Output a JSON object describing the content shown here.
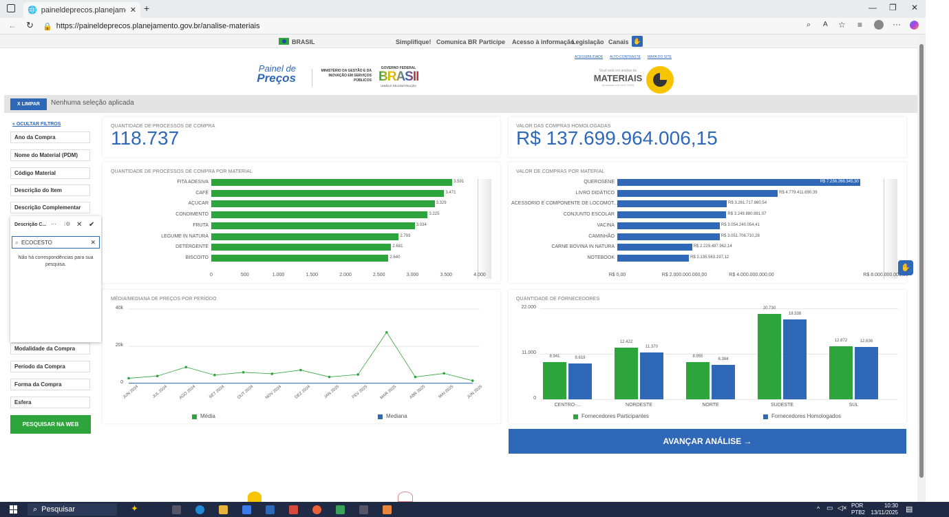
{
  "browser": {
    "tab_title": "paineldeprecos.planejamento.go",
    "url": "https://paineldeprecos.planejamento.gov.br/analise-materiais"
  },
  "gov_bar": {
    "country": "BRASIL",
    "links": [
      "Simplifique!",
      "Comunica BR",
      "Participe",
      "Acesso à informação",
      "Legislação",
      "Canais"
    ]
  },
  "header": {
    "logo_line1": "Painel de",
    "logo_line2": "Preços",
    "ministry": "MINISTÉRIO DA GESTÃO E DA INOVAÇÃO EM SERVIÇOS PÚBLICOS",
    "gov_label": "GOVERNO FEDERAL",
    "gov_word": "BRASIL",
    "gov_sub": "UNIÃO E RECONSTRUÇÃO",
    "access_links": [
      "ACESSIBILIDADE",
      "ALTO CONTRASTE",
      "MAPA DO SITE"
    ],
    "subtitle": "Você está em análise de",
    "title": "MATERIAIS",
    "updated": "Atualizado em 04/07/2025"
  },
  "selection": {
    "clear_label": "X LIMPAR",
    "status": "Nenhuma seleção aplicada"
  },
  "sidebar": {
    "hide_label": "« OCULTAR FILTROS",
    "filters_top": [
      "Ano da Compra",
      "Nome do Material (PDM)",
      "Código Material",
      "Descrição do Item",
      "Descrição Complementar"
    ],
    "filters_bottom": [
      "Modalidade da Compra",
      "Período da Compra",
      "Forma da Compra",
      "Esfera"
    ],
    "search_web": "PESQUISAR NA WEB"
  },
  "popup": {
    "title": "Descrição C...",
    "search_value": "ECOCESTO",
    "empty": "Não há correspondências para sua pesquisa."
  },
  "kpi": {
    "processes_title": "QUANTIDADE DE PROCESSOS DE COMPRA",
    "processes_value": "118.737",
    "value_title": "VALOR DAS COMPRAS HOMOLOGADAS",
    "value_value": "R$ 137.699.964.006,15"
  },
  "chart_data": [
    {
      "type": "bar",
      "orientation": "horizontal",
      "title": "QUANTIDADE DE PROCESSOS DE COMPRA POR MATERIAL",
      "categories": [
        "FITA ADESIVA",
        "CAFÉ",
        "AÇÚCAR",
        "CONDIMENTO",
        "FRUTA",
        "LEGUME IN NATURA",
        "DETERGENTE",
        "BISCOITO"
      ],
      "values": [
        3591,
        3471,
        3329,
        3225,
        3034,
        2793,
        2681,
        2640
      ],
      "value_labels": [
        "3.591",
        "3.471",
        "3.329",
        "3.225",
        "3.034",
        "2.793",
        "2.681",
        "2.640"
      ],
      "xlim": [
        0,
        4000
      ],
      "xticks": [
        "0",
        "500",
        "1.000",
        "1.500",
        "2.000",
        "2.500",
        "3.000",
        "3.500",
        "4.000"
      ],
      "color": "#2ea43c"
    },
    {
      "type": "bar",
      "orientation": "horizontal",
      "title": "VALOR DE COMPRAS POR MATERIAL",
      "categories": [
        "QUEROSENE",
        "LIVRO DIDÁTICO",
        "ACESSORIO E COMPONENTE DE LOCOMOT...",
        "CONJUNTO ESCOLAR",
        "VACINA",
        "CAMINHÃO",
        "CARNE BOVINA IN NATURA",
        "NOTEBOOK"
      ],
      "values": [
        7236266345.3,
        4779411690.39,
        3261717860.54,
        3249880881.07,
        3054240054.41,
        3051706710.28,
        2229497962.14,
        2135563197.12
      ],
      "value_labels": [
        "R$ 7.236.266.345,30",
        "R$ 4.779.411.690,39",
        "R$ 3.261.717.860,54",
        "R$ 3.249.880.881,07",
        "R$ 3.054.240.054,41",
        "R$ 3.051.706.710,28",
        "R$ 2.229.497.962,14",
        "R$ 2.135.563.197,12"
      ],
      "xlim": [
        0,
        8000000000
      ],
      "xticks": [
        "R$ 0,00",
        "R$ 2.000.000.000,00",
        "R$ 4.000.000.000,00",
        "R$ 8.000.000.000,00"
      ],
      "color": "#2f68b6"
    },
    {
      "type": "line",
      "title": "MÉDIA/MEDIANA DE PREÇOS POR PERÍODO",
      "x": [
        "JUN 2024",
        "JUL 2024",
        "AGO 2024",
        "SET 2024",
        "OUT 2024",
        "NOV 2024",
        "DEZ 2024",
        "JAN 2025",
        "FEV 2025",
        "MAR 2025",
        "ABR 2025",
        "MAI 2025",
        "JUN 2025"
      ],
      "ylim": [
        0,
        40000
      ],
      "yticks": [
        "0",
        "20k",
        "40k"
      ],
      "series": [
        {
          "name": "Média",
          "color": "#2ea43c",
          "values": [
            2800,
            4000,
            8800,
            4500,
            6000,
            5200,
            7200,
            3500,
            4800,
            27500,
            3500,
            5400,
            1500
          ]
        },
        {
          "name": "Mediana",
          "color": "#2f68b6",
          "values": [
            150,
            150,
            150,
            150,
            150,
            150,
            150,
            150,
            150,
            150,
            150,
            150,
            150
          ]
        }
      ]
    },
    {
      "type": "bar",
      "title": "QUANTIDADE DE FORNECEDORES",
      "categories": [
        "CENTRO-...",
        "NORDESTE",
        "NORTE",
        "SUDESTE",
        "SUL"
      ],
      "ylim": [
        0,
        22000
      ],
      "yticks": [
        "0",
        "11.000",
        "22.000"
      ],
      "series": [
        {
          "name": "Fornecedores Participantes",
          "color": "#2ea43c",
          "values": [
            8941,
            12422,
            8955,
            20730,
            12872
          ],
          "labels": [
            "8.941",
            "12.422",
            "8.955",
            "20.730",
            "12.872"
          ]
        },
        {
          "name": "Fornecedores Homologados",
          "color": "#2f68b6",
          "values": [
            8619,
            11370,
            8384,
            19338,
            12636
          ],
          "labels": [
            "8.619",
            "11.370",
            "8.384",
            "19.338",
            "12.636"
          ]
        }
      ]
    }
  ],
  "advance": {
    "label": "AVANÇAR ANÁLISE →"
  },
  "taskbar": {
    "search": "Pesquisar",
    "lang": "POR",
    "lang2": "PTB2",
    "time": "10:30",
    "date": "13/11/2025"
  }
}
